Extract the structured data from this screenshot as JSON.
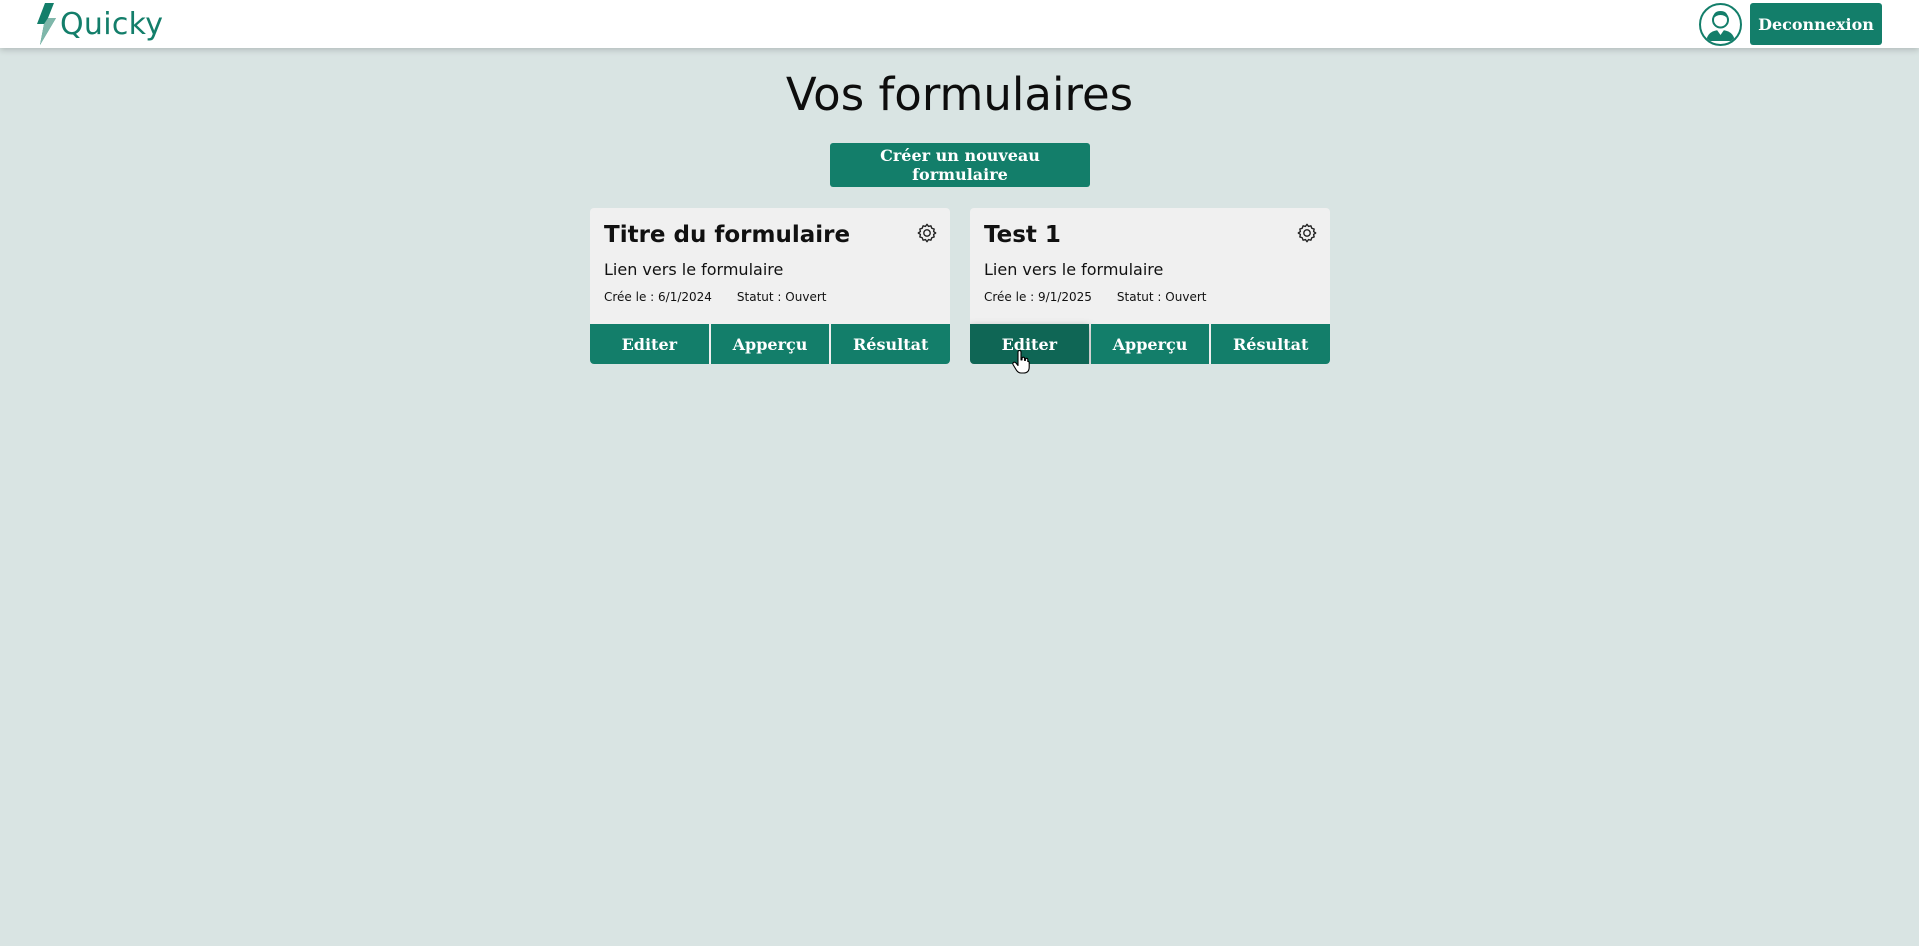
{
  "app": {
    "name": "Quicky",
    "logo_icon": "lightning-bolt-icon"
  },
  "header": {
    "avatar_icon": "user-avatar-icon",
    "logout_label": "Deconnexion"
  },
  "main": {
    "title": "Vos formulaires",
    "create_label": "Créer un nouveau formulaire"
  },
  "forms": [
    {
      "title": "Titre du formulaire",
      "link_label": "Lien vers le formulaire",
      "created": "Crée le : 6/1/2024",
      "status": "Statut : Ouvert",
      "actions": {
        "edit": "Editer",
        "preview": "Apperçu",
        "results": "Résultat"
      }
    },
    {
      "title": "Test 1",
      "link_label": "Lien vers le formulaire",
      "created": "Crée le : 9/1/2025",
      "status": "Statut : Ouvert",
      "actions": {
        "edit": "Editer",
        "preview": "Apperçu",
        "results": "Résultat"
      }
    }
  ],
  "colors": {
    "accent": "#137e6a",
    "background": "#d9e4e3",
    "card": "#f0f0f0"
  }
}
